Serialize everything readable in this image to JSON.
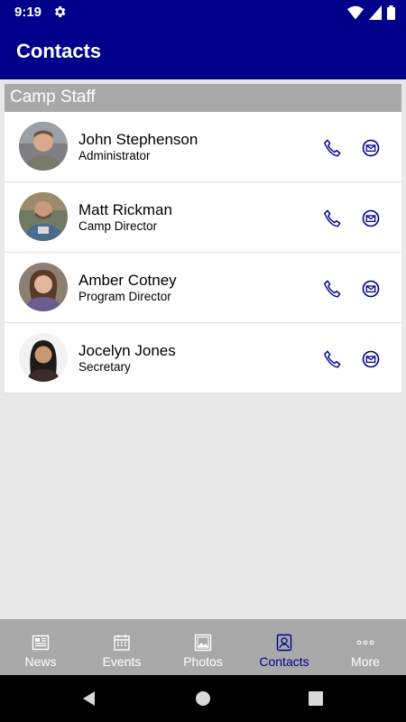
{
  "status": {
    "time": "9:19"
  },
  "header": {
    "title": "Contacts"
  },
  "section": {
    "title": "Camp Staff"
  },
  "contacts": [
    {
      "name": "John Stephenson",
      "role": "Administrator"
    },
    {
      "name": "Matt Rickman",
      "role": "Camp Director"
    },
    {
      "name": "Amber  Cotney",
      "role": "Program Director"
    },
    {
      "name": "Jocelyn Jones",
      "role": "Secretary"
    }
  ],
  "nav": {
    "items": [
      {
        "label": "News",
        "icon": "newspaper-icon"
      },
      {
        "label": "Events",
        "icon": "calendar-icon"
      },
      {
        "label": "Photos",
        "icon": "photo-icon"
      },
      {
        "label": "Contacts",
        "icon": "contact-card-icon"
      },
      {
        "label": "More",
        "icon": "more-dots-icon"
      }
    ],
    "active": "Contacts"
  },
  "colors": {
    "primary": "#00008b",
    "section_header": "#a9a9a9",
    "bottom_nav": "#a9a9a9",
    "background": "#e8e8e8"
  }
}
